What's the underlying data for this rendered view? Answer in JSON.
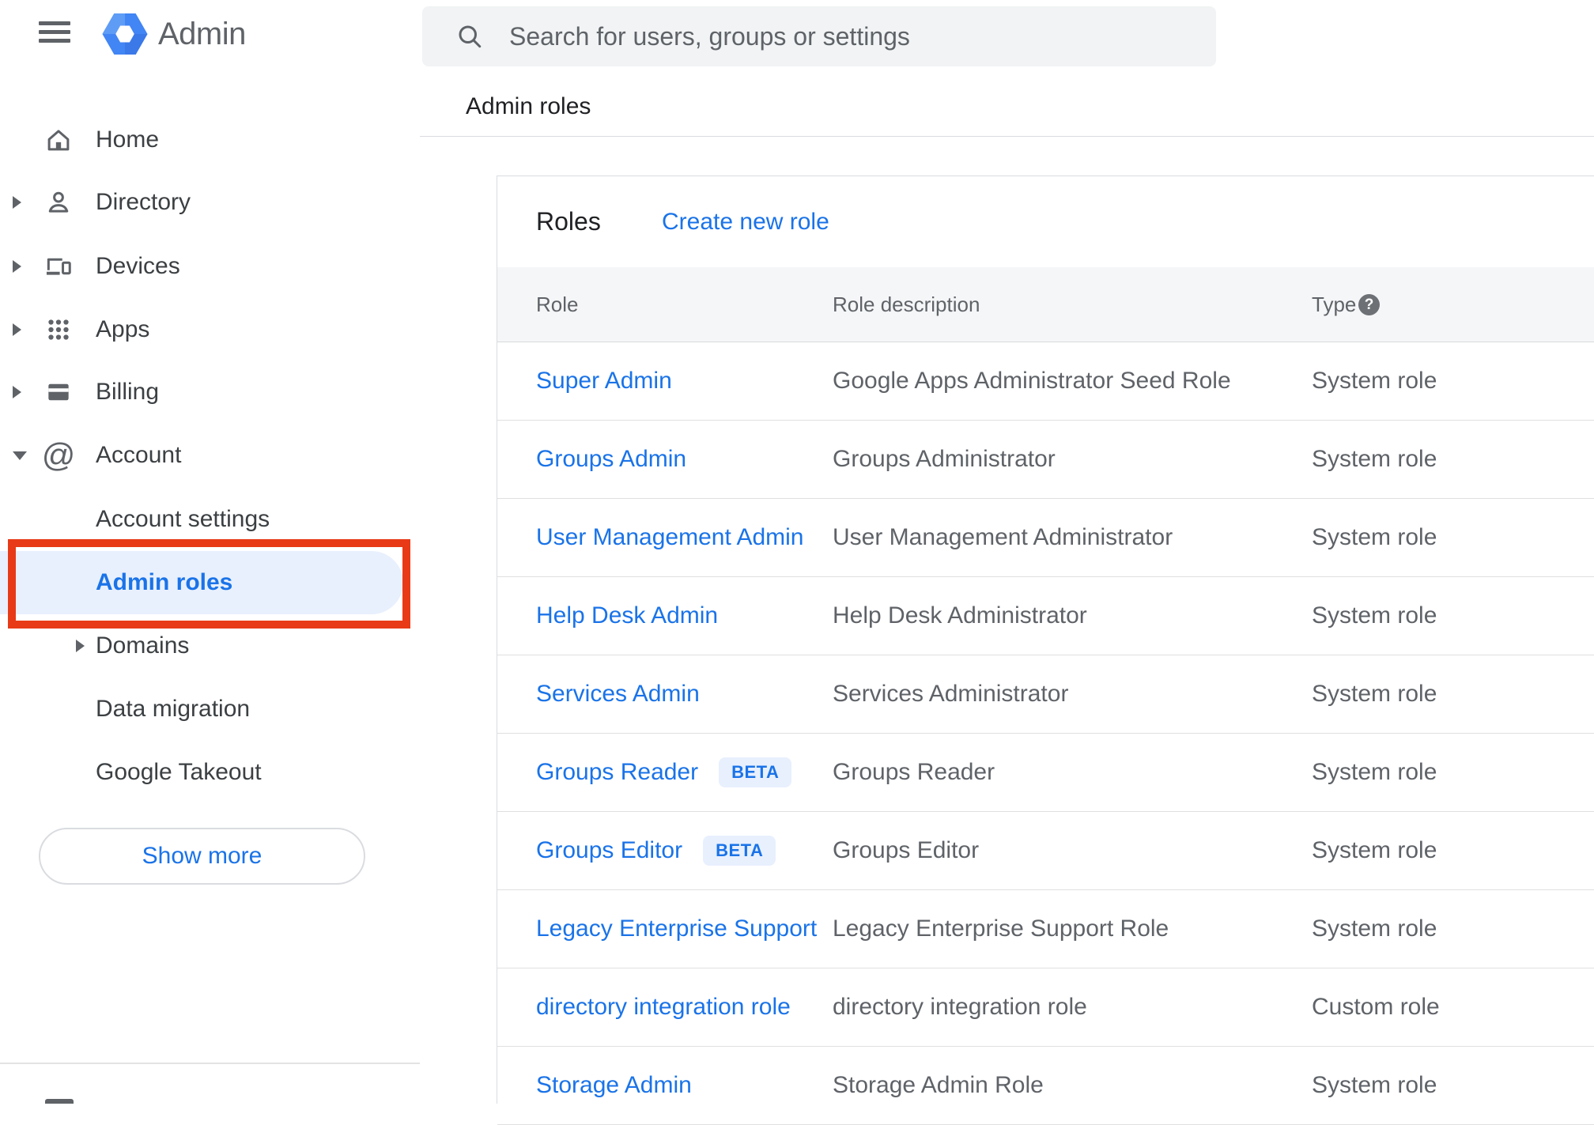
{
  "header": {
    "product_name": "Admin",
    "search_placeholder": "Search for users, groups or settings"
  },
  "breadcrumb": "Admin roles",
  "sidebar": {
    "items": [
      {
        "label": "Home",
        "icon": "home",
        "arrow": "none",
        "level": 0,
        "selected": false
      },
      {
        "label": "Directory",
        "icon": "person",
        "arrow": "right",
        "level": 0,
        "selected": false
      },
      {
        "label": "Devices",
        "icon": "devices",
        "arrow": "right",
        "level": 0,
        "selected": false
      },
      {
        "label": "Apps",
        "icon": "apps",
        "arrow": "right",
        "level": 0,
        "selected": false
      },
      {
        "label": "Billing",
        "icon": "card",
        "arrow": "right",
        "level": 0,
        "selected": false
      },
      {
        "label": "Account",
        "icon": "at",
        "arrow": "down",
        "level": 0,
        "selected": false
      },
      {
        "label": "Account settings",
        "icon": "",
        "arrow": "none",
        "level": 1,
        "selected": false
      },
      {
        "label": "Admin roles",
        "icon": "",
        "arrow": "none",
        "level": 1,
        "selected": true,
        "annotated": true
      },
      {
        "label": "Domains",
        "icon": "",
        "arrow": "right",
        "level": 1,
        "selected": false
      },
      {
        "label": "Data migration",
        "icon": "",
        "arrow": "none",
        "level": 1,
        "selected": false
      },
      {
        "label": "Google Takeout",
        "icon": "",
        "arrow": "none",
        "level": 1,
        "selected": false
      }
    ],
    "show_more_label": "Show more"
  },
  "main": {
    "card_title": "Roles",
    "create_link": "Create new role",
    "table": {
      "columns": [
        "Role",
        "Role description",
        "Type"
      ],
      "type_help_icon": "question-mark",
      "beta_badge_label": "BETA",
      "rows": [
        {
          "role": "Super Admin",
          "beta": false,
          "description": "Google Apps Administrator Seed Role",
          "type": "System role"
        },
        {
          "role": "Groups Admin",
          "beta": false,
          "description": "Groups Administrator",
          "type": "System role"
        },
        {
          "role": "User Management Admin",
          "beta": false,
          "description": "User Management Administrator",
          "type": "System role"
        },
        {
          "role": "Help Desk Admin",
          "beta": false,
          "description": "Help Desk Administrator",
          "type": "System role"
        },
        {
          "role": "Services Admin",
          "beta": false,
          "description": "Services Administrator",
          "type": "System role"
        },
        {
          "role": "Groups Reader",
          "beta": true,
          "description": "Groups Reader",
          "type": "System role"
        },
        {
          "role": "Groups Editor",
          "beta": true,
          "description": "Groups Editor",
          "type": "System role"
        },
        {
          "role": "Legacy Enterprise Support",
          "beta": false,
          "description": "Legacy Enterprise Support Role",
          "type": "System role"
        },
        {
          "role": "directory integration role",
          "beta": false,
          "description": "directory integration role",
          "type": "Custom role"
        },
        {
          "role": "Storage Admin",
          "beta": false,
          "description": "Storage Admin Role",
          "type": "System role"
        }
      ]
    }
  },
  "colors": {
    "accent_blue": "#1a73e8",
    "selection_bg": "#e8f0fe",
    "annotation_red": "#e83a17",
    "text_primary": "#202124",
    "text_secondary": "#5f6368",
    "search_bg": "#f1f3f4",
    "table_header_bg": "#f5f6f7",
    "border": "#dadce0"
  }
}
